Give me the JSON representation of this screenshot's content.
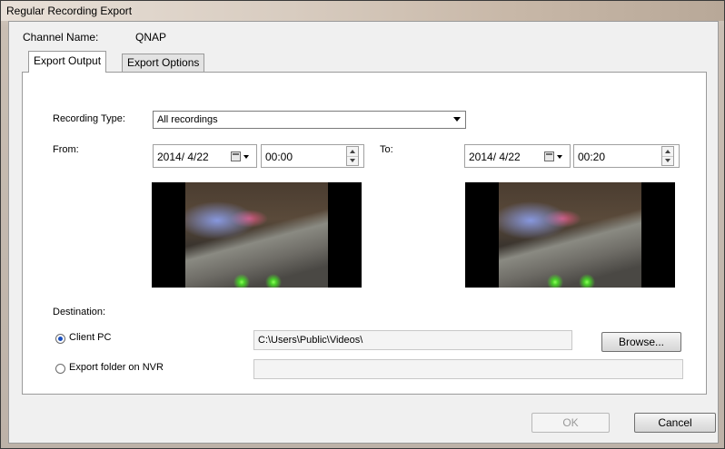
{
  "window": {
    "title": "Regular Recording Export"
  },
  "channel": {
    "label": "Channel Name:",
    "value": "QNAP"
  },
  "tabs": [
    {
      "label": "Export Output",
      "active": true
    },
    {
      "label": "Export Options",
      "active": false
    }
  ],
  "recording_type": {
    "label": "Recording Type:",
    "selected": "All recordings"
  },
  "from": {
    "label": "From:",
    "date": "2014/  4/22",
    "time": "00:00"
  },
  "to": {
    "label": "To:",
    "date": "2014/  4/22",
    "time": "00:20"
  },
  "destination": {
    "label": "Destination:",
    "client_pc": {
      "label": "Client PC",
      "checked": true,
      "path": "C:\\Users\\Public\\Videos\\"
    },
    "nvr": {
      "label": "Export folder on NVR",
      "checked": false,
      "path": ""
    },
    "browse_label": "Browse..."
  },
  "buttons": {
    "ok": "OK",
    "cancel": "Cancel"
  },
  "icons": {
    "calendar": "calendar-icon",
    "dropdown": "chevron-down-icon",
    "spinner": "spin-arrows-icon"
  }
}
